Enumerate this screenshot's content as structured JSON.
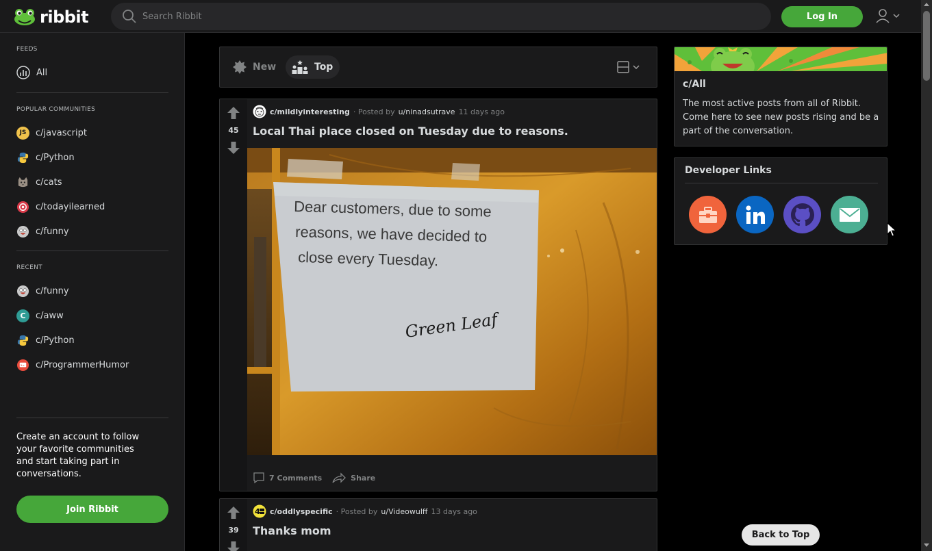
{
  "header": {
    "logo_text": "ribbit",
    "search_placeholder": "Search Ribbit",
    "login_label": "Log In"
  },
  "sidebar": {
    "feeds_title": "FEEDS",
    "feeds": [
      {
        "label": "All"
      }
    ],
    "popular_title": "POPULAR COMMUNITIES",
    "popular": [
      {
        "label": "c/javascript",
        "badge": "JS",
        "color": "#f0c24b"
      },
      {
        "label": "c/Python",
        "color": "#3776ab"
      },
      {
        "label": "c/cats",
        "color": "#8a8a8a"
      },
      {
        "label": "c/todayilearned",
        "color": "#d93a49"
      },
      {
        "label": "c/funny",
        "color": "#b8b8b8"
      }
    ],
    "recent_title": "RECENT",
    "recent": [
      {
        "label": "c/funny",
        "color": "#b8b8b8"
      },
      {
        "label": "c/aww",
        "badge": "C",
        "color": "#2f9c95"
      },
      {
        "label": "c/Python",
        "color": "#3776ab"
      },
      {
        "label": "c/ProgrammerHumor",
        "color": "#e84c3d"
      }
    ],
    "cta_text": "Create an account to follow your favorite communities and start taking part in conversations.",
    "join_label": "Join Ribbit"
  },
  "sortbar": {
    "new_label": "New",
    "top_label": "Top"
  },
  "posts": [
    {
      "votes": "45",
      "subreddit": "c/mildlyinteresting",
      "posted_by_prefix": "· Posted by",
      "user": "u/ninadsutrave",
      "time": "11 days ago",
      "title": "Local Thai place closed on Tuesday due to reasons.",
      "image_text": {
        "line1": "Dear customers, due to some",
        "line2": "reasons, we have decided to",
        "line3": "close every Tuesday.",
        "signature": "Green Leaf"
      },
      "comments_label": "7 Comments",
      "share_label": "Share"
    },
    {
      "votes": "39",
      "subreddit": "c/oddlyspecific",
      "posted_by_prefix": "· Posted by",
      "user": "u/Videowulff",
      "time": "13 days ago",
      "title": "Thanks mom"
    }
  ],
  "about": {
    "title": "c/All",
    "description": "The most active posts from all of Ribbit. Come here to see new posts rising and be a part of the conversation."
  },
  "devlinks": {
    "title": "Developer Links",
    "links": [
      {
        "icon": "portfolio-icon",
        "color": "#f0643c"
      },
      {
        "icon": "linkedin-icon",
        "color": "#0a66c2"
      },
      {
        "icon": "github-icon",
        "color": "#5b4fc4"
      },
      {
        "icon": "email-icon",
        "color": "#4caf93"
      }
    ]
  },
  "back_to_top_label": "Back to Top",
  "colors": {
    "accent": "#46a73a",
    "background": "#000000",
    "surface": "#1a1a1b"
  }
}
